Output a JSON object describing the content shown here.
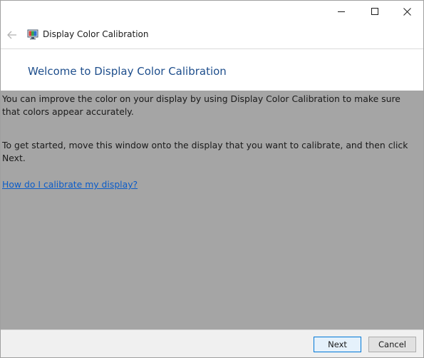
{
  "window": {
    "controls": {
      "minimize_icon": "minimize-icon",
      "maximize_icon": "maximize-icon",
      "close_icon": "close-icon"
    }
  },
  "navbar": {
    "back_icon": "back-arrow-icon",
    "app_icon": "display-color-calibration-icon",
    "title": "Display Color Calibration"
  },
  "header": {
    "heading": "Welcome to Display Color Calibration"
  },
  "content": {
    "paragraph1": "You can improve the color on your display by using Display Color Calibration to make sure that colors appear accurately.",
    "paragraph2": "To get started, move this window onto the display that you want to calibrate, and then click Next.",
    "help_link": "How do I calibrate my display?"
  },
  "footer": {
    "next_label": "Next",
    "cancel_label": "Cancel"
  },
  "colors": {
    "heading": "#1e4e8c",
    "link": "#0b5cc9",
    "content_background": "#a5a5a5",
    "primary_button_border": "#0078d7"
  }
}
